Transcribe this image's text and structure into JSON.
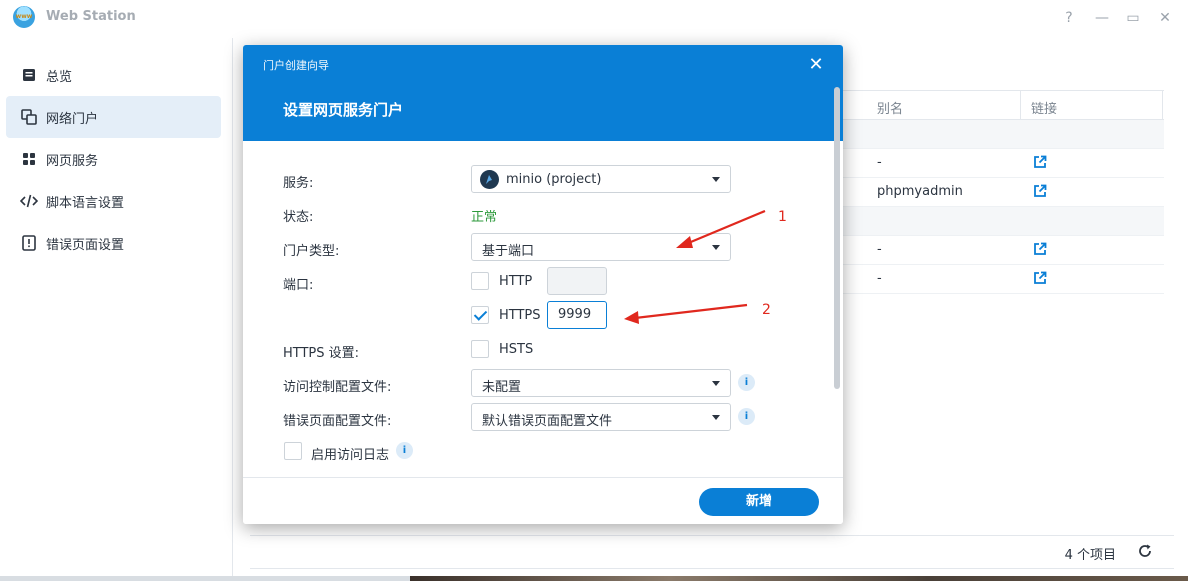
{
  "app": {
    "title": "Web Station"
  },
  "window_controls": {
    "help": "?",
    "minimize": "—",
    "maximize": "▭",
    "close": "✕"
  },
  "sidebar": {
    "items": [
      {
        "label": "总览",
        "icon": "overview-icon",
        "active": false
      },
      {
        "label": "网络门户",
        "icon": "portal-icon",
        "active": true
      },
      {
        "label": "网页服务",
        "icon": "web-service-icon",
        "active": false
      },
      {
        "label": "脚本语言设置",
        "icon": "code-icon",
        "active": false
      },
      {
        "label": "错误页面设置",
        "icon": "error-page-icon",
        "active": false
      }
    ]
  },
  "table": {
    "columns": {
      "alias": "别名",
      "link": "链接"
    },
    "rows": [
      {
        "alias": "-",
        "link_icon": "external-link-icon"
      },
      {
        "alias": "phpmyadmin",
        "link_icon": "external-link-icon"
      },
      {
        "alias": "",
        "link_icon": ""
      },
      {
        "alias": "-",
        "link_icon": "external-link-icon"
      },
      {
        "alias": "-",
        "link_icon": "external-link-icon"
      }
    ],
    "item_count": "4 个项目"
  },
  "modal": {
    "small_title": "门户创建向导",
    "big_title": "设置网页服务门户",
    "close": "✕",
    "fields": {
      "service_label": "服务:",
      "service_value": "minio (project)",
      "status_label": "状态:",
      "status_value": "正常",
      "portal_type_label": "门户类型:",
      "portal_type_value": "基于端口",
      "port_label": "端口:",
      "http_label": "HTTP",
      "http_checked": false,
      "http_port": "",
      "https_label": "HTTPS",
      "https_checked": true,
      "https_port": "9999",
      "https_settings_label": "HTTPS 设置:",
      "hsts_label": "HSTS",
      "hsts_checked": false,
      "access_control_label": "访问控制配置文件:",
      "access_control_value": "未配置",
      "error_page_label": "错误页面配置文件:",
      "error_page_value": "默认错误页面配置文件",
      "access_log_label": "启用访问日志",
      "access_log_checked": false
    },
    "primary_button": "新增",
    "info_glyph": "i"
  },
  "annotations": {
    "arrow1": "1",
    "arrow2": "2"
  },
  "colors": {
    "accent": "#0a7fd6",
    "status_ok": "#2e9a3c",
    "annotation": "#e0281e"
  }
}
